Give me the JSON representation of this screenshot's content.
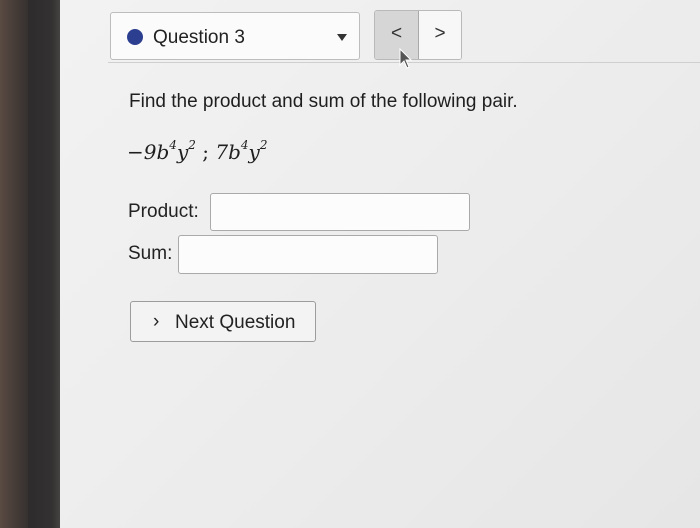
{
  "question_selector": {
    "label": "Question 3",
    "accent": "#2c3e8f"
  },
  "nav": {
    "prev_glyph": "<",
    "next_glyph": ">"
  },
  "problem": {
    "prompt": "Find the product and sum of the following pair.",
    "expr_a_coeff": "−9b",
    "expr_a_exp1": "4",
    "expr_a_var2": "y",
    "expr_a_exp2": "2",
    "separator": " ; ",
    "expr_b_coeff": "7b",
    "expr_b_exp1": "4",
    "expr_b_var2": "y",
    "expr_b_exp2": "2"
  },
  "fields": {
    "product_label": "Product:",
    "product_value": "",
    "sum_label": "Sum:",
    "sum_value": ""
  },
  "next_button": {
    "chevron": "›",
    "label": "Next Question"
  }
}
